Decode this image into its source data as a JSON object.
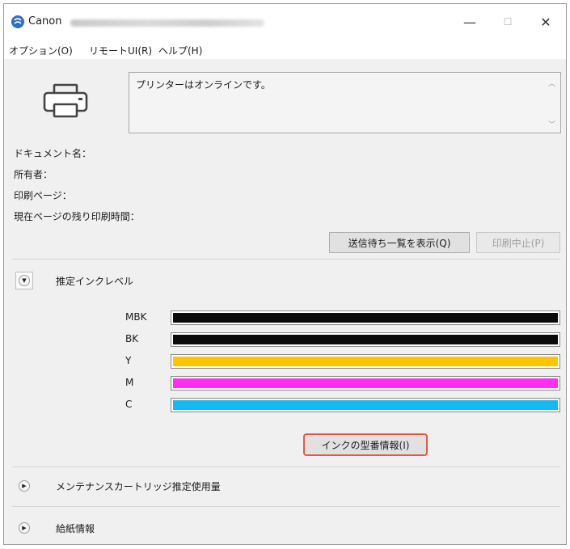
{
  "window": {
    "app_name": "Canon",
    "minimize_glyph": "—",
    "maximize_glyph": "☐",
    "close_glyph": "✕"
  },
  "menu": [
    {
      "label": "オプション(O)"
    },
    {
      "label": "リモートUI(R)"
    },
    {
      "label": "ヘルプ(H)"
    }
  ],
  "status": {
    "message": "プリンターはオンラインです。"
  },
  "info": {
    "document_name": "ドキュメント名：",
    "owner": "所有者：",
    "printing_page": "印刷ページ：",
    "remaining_time": "現在ページの残り印刷時間："
  },
  "buttons": {
    "print_queue": "送信待ち一覧を表示(Q)",
    "cancel_printing": "印刷中止(P)",
    "ink_model_info": "インクの型番情報(I)"
  },
  "sections": {
    "ink_level": "推定インクレベル",
    "maintenance": "メンテナンスカートリッジ推定使用量",
    "paper_info": "給紙情報"
  },
  "inks": [
    {
      "name": "MBK",
      "color": "#0a0a0a",
      "level_pct": 100
    },
    {
      "name": "BK",
      "color": "#0a0a0a",
      "level_pct": 100
    },
    {
      "name": "Y",
      "color": "#ffc400",
      "level_pct": 100
    },
    {
      "name": "M",
      "color": "#ff2ef0",
      "level_pct": 100
    },
    {
      "name": "C",
      "color": "#14b9f2",
      "level_pct": 100
    }
  ],
  "colors": {
    "highlight": "#e05a4a"
  }
}
